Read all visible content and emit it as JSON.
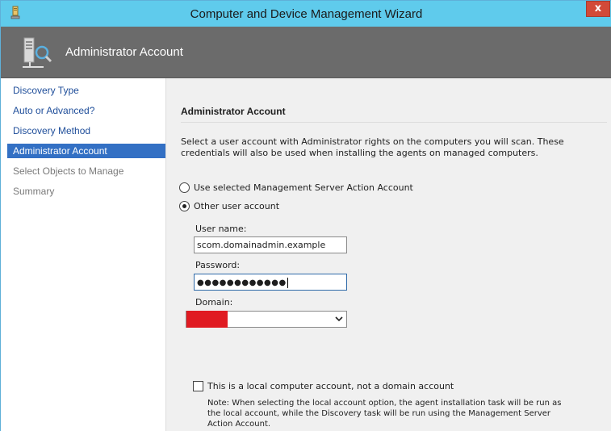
{
  "window": {
    "title": "Computer and Device Management Wizard",
    "close_label": "x"
  },
  "header": {
    "title": "Administrator Account",
    "icon": "server-discovery-icon"
  },
  "sidebar": {
    "items": [
      {
        "label": "Discovery Type",
        "state": "link"
      },
      {
        "label": "Auto or Advanced?",
        "state": "link"
      },
      {
        "label": "Discovery Method",
        "state": "link"
      },
      {
        "label": "Administrator Account",
        "state": "active"
      },
      {
        "label": "Select Objects to Manage",
        "state": "disabled"
      },
      {
        "label": "Summary",
        "state": "disabled"
      }
    ]
  },
  "main": {
    "section_title": "Administrator Account",
    "description": "Select a user account with Administrator rights on the computers you will scan. These credentials will also be used when installing the agents on managed computers.",
    "radio_options": [
      {
        "label": "Use selected Management Server Action Account",
        "checked": false
      },
      {
        "label": "Other user account",
        "checked": true
      }
    ],
    "username": {
      "label": "User name:",
      "value": "scom.domainadmin.example"
    },
    "password": {
      "label": "Password:",
      "value": "●●●●●●●●●●●●"
    },
    "domain": {
      "label": "Domain:",
      "value": ""
    },
    "local_account_checkbox": {
      "label": "This is a local computer account, not a domain account",
      "checked": false
    },
    "note": "Note:  When selecting the local account option, the agent installation task will be run as the local account, while the Discovery task will be run using the Management Server Action Account."
  },
  "colors": {
    "titlebar": "#5fcbec",
    "header": "#6b6b6b",
    "active_nav": "#3370c4",
    "nav_link": "#1f4e9a",
    "close_button": "#d24a38",
    "redaction": "#e01b22"
  }
}
